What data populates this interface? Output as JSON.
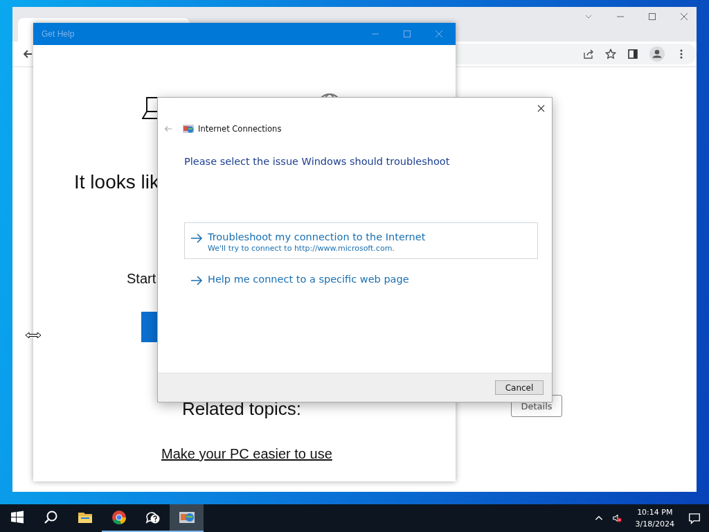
{
  "get_help": {
    "title": "Get Help",
    "heading": "It looks lik",
    "prompt": "Start",
    "related_heading": "Related topics:",
    "related_link": "Make your PC easier to use"
  },
  "browser": {
    "details_button": "Details"
  },
  "dialog": {
    "title": "Internet Connections",
    "heading": "Please select the issue Windows should troubleshoot",
    "options": [
      {
        "title": "Troubleshoot my connection to the Internet",
        "subtitle": "We'll try to connect to http://www.microsoft.com.",
        "selected": true
      },
      {
        "title": "Help me connect to a specific web page",
        "selected": false
      }
    ],
    "cancel_button": "Cancel"
  },
  "taskbar": {
    "items": [
      {
        "kind": "start",
        "running": false,
        "selected": false
      },
      {
        "kind": "search",
        "running": false,
        "selected": false
      },
      {
        "kind": "folder",
        "running": false,
        "selected": false
      },
      {
        "kind": "browser",
        "running": true,
        "selected": false
      },
      {
        "kind": "help",
        "running": true,
        "selected": false
      },
      {
        "kind": "troubleshooter",
        "running": true,
        "selected": true
      }
    ],
    "time": "10:14 PM",
    "date": "3/18/2024"
  }
}
